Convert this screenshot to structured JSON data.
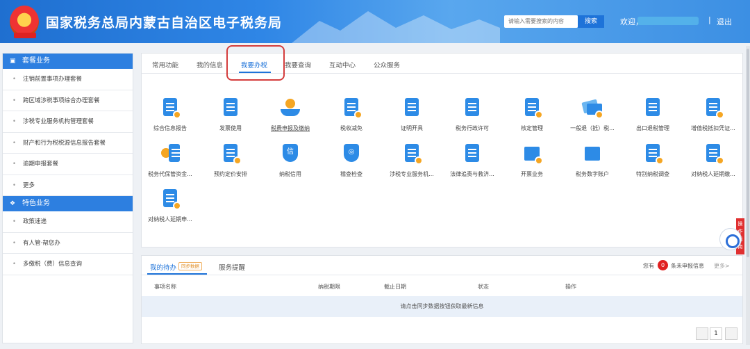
{
  "header": {
    "title": "国家税务总局内蒙古自治区电子税务局",
    "search_placeholder": "请输入需要搜索的内容",
    "search_button": "搜索",
    "welcome": "欢迎，",
    "separator": "|",
    "logout": "退出"
  },
  "sidebar": {
    "section1": {
      "title": "套餐业务",
      "icon": "grid-icon"
    },
    "items1": [
      "注销前置事项办理套餐",
      "跨区域涉税事项综合办理套餐",
      "涉税专业服务机构管理套餐",
      "财产和行为税税源信息报告套餐",
      "逾期申报套餐",
      "更多"
    ],
    "section2": {
      "title": "特色业务",
      "icon": "grid-icon"
    },
    "items2": [
      "政策速递",
      "有人管·帮您办",
      "多缴税（费）信息查询"
    ]
  },
  "main": {
    "tabs": [
      "常用功能",
      "我的信息",
      "我要办税",
      "我要查询",
      "互动中心",
      "公众服务"
    ],
    "active_tab": "我要办税",
    "functions": [
      {
        "label": "综合信息报告",
        "icon": "document-icon"
      },
      {
        "label": "发票使用",
        "icon": "invoice-icon"
      },
      {
        "label": "税费申报及缴纳",
        "icon": "tax-payment-icon"
      },
      {
        "label": "税收减免",
        "icon": "tax-reduction-icon"
      },
      {
        "label": "证明开具",
        "icon": "certificate-icon"
      },
      {
        "label": "税务行政许可",
        "icon": "permit-icon"
      },
      {
        "label": "核定管理",
        "icon": "assessment-icon"
      },
      {
        "label": "一般退（抵）税...",
        "icon": "refund-icon"
      },
      {
        "label": "出口退税管理",
        "icon": "export-refund-icon"
      },
      {
        "label": "增值税抵扣凭证...",
        "icon": "vat-deduction-icon"
      },
      {
        "label": "税务代保管资金...",
        "icon": "custody-fund-icon"
      },
      {
        "label": "预约定价安排",
        "icon": "pricing-icon"
      },
      {
        "label": "纳税信用",
        "icon": "credit-icon"
      },
      {
        "label": "稽查检查",
        "icon": "inspection-icon"
      },
      {
        "label": "涉税专业服务机...",
        "icon": "agency-icon"
      },
      {
        "label": "法律追责与救济...",
        "icon": "legal-icon"
      },
      {
        "label": "开票业务",
        "icon": "invoicing-icon"
      },
      {
        "label": "税务数字账户",
        "icon": "digital-account-icon"
      },
      {
        "label": "特别纳税调查",
        "icon": "special-investigation-icon"
      },
      {
        "label": "对纳税人延期缴...",
        "icon": "deferral-icon"
      },
      {
        "label": "对纳税人延期申...",
        "icon": "deferral-declare-icon"
      }
    ]
  },
  "bottom": {
    "tabs": [
      "我的待办",
      "服务提醒"
    ],
    "sync_tag": "同步数据",
    "notice_prefix": "您有",
    "count": "0",
    "notice_suffix": "条未申报信息",
    "more": "更多>",
    "columns": [
      "事项名称",
      "纳税期限",
      "截止日期",
      "状态",
      "操作"
    ],
    "empty_message": "请点击同步数据按钮获取最新信息",
    "page": "1"
  },
  "float": {
    "guide_label": "操作指南"
  },
  "colors": {
    "primary": "#1e73d9",
    "header": "#2f86e6",
    "highlight": "#d43c3c",
    "badge": "#e02020"
  }
}
